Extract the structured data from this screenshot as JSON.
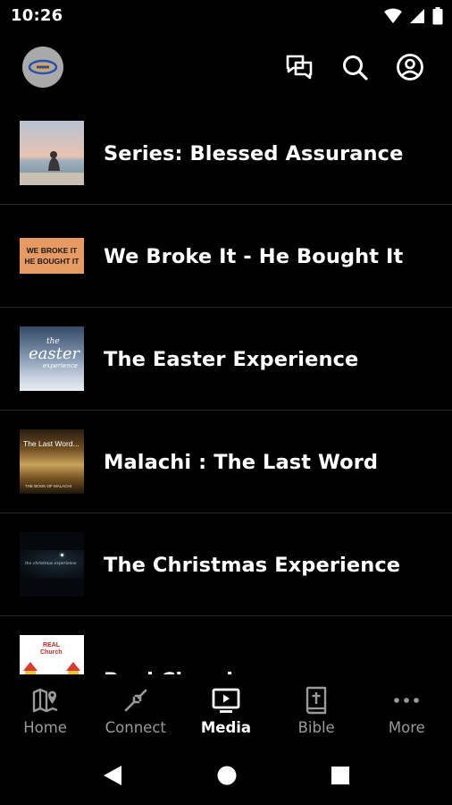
{
  "status": {
    "time": "10:26"
  },
  "media_items": [
    {
      "title": "Series: Blessed Assurance"
    },
    {
      "title": "We Broke It - He Bought It",
      "thumb_text_1": "WE BROKE IT",
      "thumb_text_2": "HE BOUGHT IT"
    },
    {
      "title": "The Easter Experience",
      "thumb_text_1": "the",
      "thumb_text_2": "easter",
      "thumb_text_3": "experience"
    },
    {
      "title": "Malachi : The Last Word",
      "thumb_text_1": "The Last Word...",
      "thumb_text_2": "THE BOOK OF MALACHI"
    },
    {
      "title": "The Christmas Experience",
      "thumb_text_1": "the christmas experience"
    },
    {
      "title": "Real Church",
      "thumb_text_1": "REAL",
      "thumb_text_2": "Church"
    }
  ],
  "nav": [
    {
      "label": "Home",
      "icon": "map-icon"
    },
    {
      "label": "Connect",
      "icon": "connect-arrows-icon"
    },
    {
      "label": "Media",
      "icon": "tv-play-icon",
      "active": true
    },
    {
      "label": "Bible",
      "icon": "bible-icon"
    },
    {
      "label": "More",
      "icon": "more-dots-icon"
    }
  ]
}
